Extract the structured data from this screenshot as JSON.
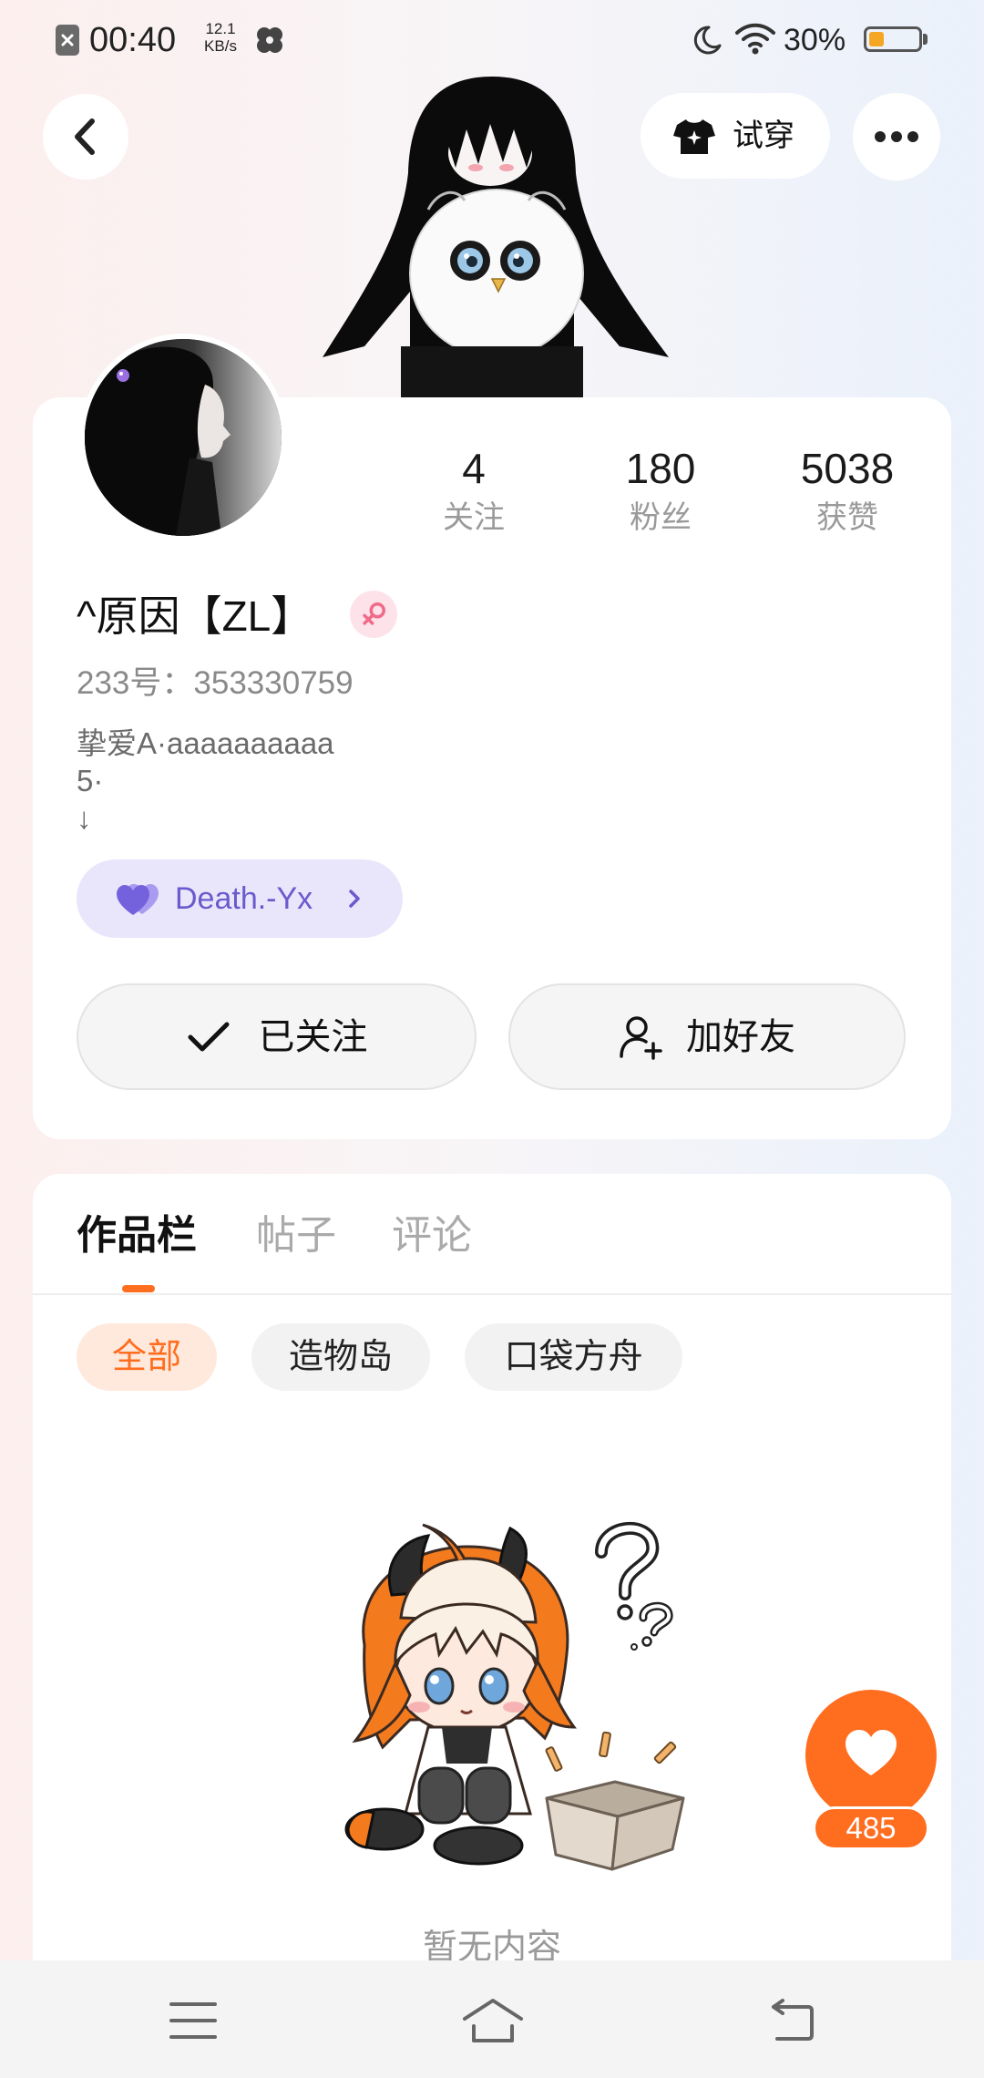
{
  "status_bar": {
    "time": "00:40",
    "net_speed_value": "12.1",
    "net_speed_unit": "KB/s",
    "battery_percent": "30%",
    "battery_level": 0.3,
    "icons": [
      "notification-blocked-icon",
      "pinwheel-icon",
      "moon-icon",
      "wifi-icon",
      "battery-icon"
    ]
  },
  "header": {
    "try_on_label": "试穿",
    "icons": {
      "back": "back-arrow-icon",
      "try_on": "tshirt-icon",
      "more": "more-dots-icon"
    }
  },
  "profile": {
    "name": "^原因【ZL】",
    "gender_icon": "female-symbol-icon",
    "id_text": "233号：353330759",
    "bio_lines": [
      "挚爱A·aaaaaaaaaa",
      "5·",
      "↓"
    ],
    "stats": [
      {
        "value": "4",
        "label": "关注"
      },
      {
        "value": "180",
        "label": "粉丝"
      },
      {
        "value": "5038",
        "label": "获赞"
      }
    ],
    "relation": {
      "name": "Death.-Yx",
      "icon": "purple-heart-icon"
    },
    "actions": {
      "follow_label": "已关注",
      "add_friend_label": "加好友"
    }
  },
  "tabs": [
    {
      "label": "作品栏",
      "active": true
    },
    {
      "label": "帖子",
      "active": false
    },
    {
      "label": "评论",
      "active": false
    }
  ],
  "filters": [
    {
      "label": "全部",
      "active": true
    },
    {
      "label": "造物岛",
      "active": false
    },
    {
      "label": "口袋方舟",
      "active": false
    }
  ],
  "empty_state": {
    "text": "暂无内容"
  },
  "like": {
    "count": "485",
    "icon": "heart-icon"
  },
  "nav_bar": {
    "icons": [
      "menu-icon",
      "home-icon",
      "back-icon"
    ]
  },
  "colors": {
    "accent": "#ff6d1f",
    "accent_light": "#ffe9dd",
    "relation_bg": "#e9e6fb",
    "relation_text": "#6a5acd",
    "gender_female": "#f06b8a",
    "card_bg": "#ffffff"
  }
}
